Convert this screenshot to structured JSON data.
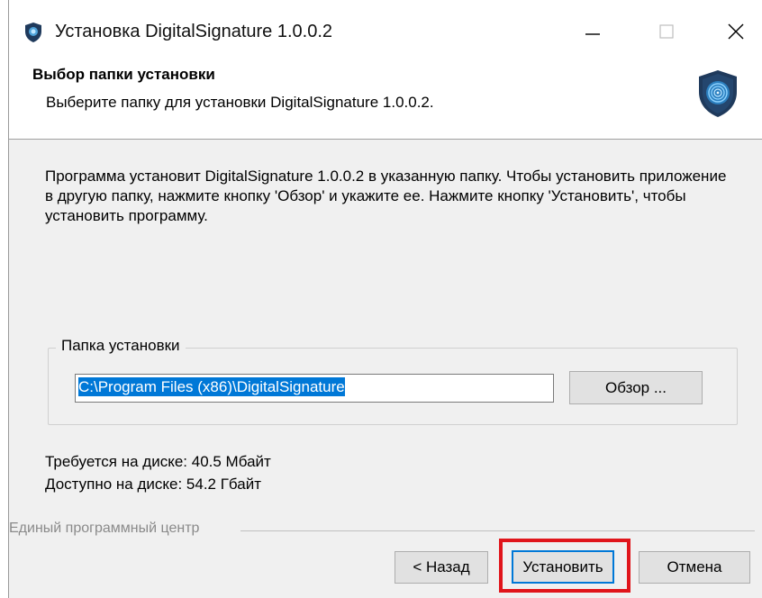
{
  "window": {
    "title": "Установка DigitalSignature  1.0.0.2"
  },
  "header": {
    "title": "Выбор папки установки",
    "subtitle": "Выберите папку для установки DigitalSignature  1.0.0.2."
  },
  "content": {
    "description": "Программа установит DigitalSignature  1.0.0.2 в указанную папку. Чтобы установить приложение в другую папку, нажмите кнопку 'Обзор' и укажите ее. Нажмите кнопку 'Установить', чтобы установить программу.",
    "group_label": "Папка установки",
    "install_path": "C:\\Program Files (x86)\\DigitalSignature",
    "browse_label": "Обзор ...",
    "disk_required": "Требуется на диске: 40.5 Мбайт",
    "disk_available": "Доступно на диске: 54.2 Гбайт"
  },
  "footer": {
    "brand": "Единый программный центр",
    "back_label": "< Назад",
    "install_label": "Установить",
    "cancel_label": "Отмена"
  },
  "colors": {
    "selection": "#0078d7",
    "highlight": "#e0151b",
    "shield": "#1f3a5c",
    "shield_glow": "#4fa3d9"
  },
  "icons": [
    "app-shield-icon",
    "minimize-icon",
    "maximize-icon",
    "close-icon",
    "shield-fingerprint-icon"
  ]
}
